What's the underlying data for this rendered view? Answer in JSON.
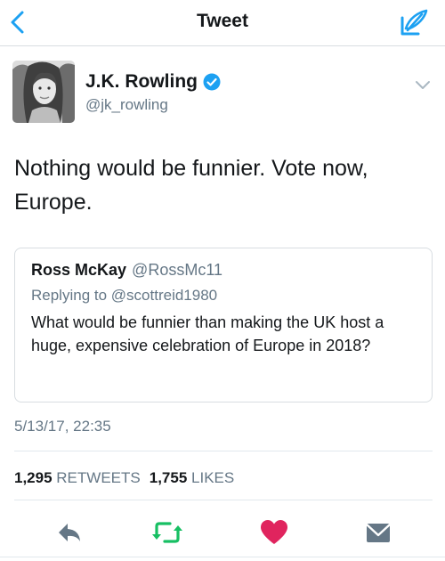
{
  "nav": {
    "title": "Tweet",
    "back_icon": "chevron-left-icon",
    "compose_icon": "compose-tweet-icon",
    "accent": "#1da1f2"
  },
  "tweet": {
    "author_name": "J.K. Rowling",
    "author_handle": "@jk_rowling",
    "verified": true,
    "text": "Nothing would be funnier. Vote now, Europe.",
    "timestamp": "5/13/17, 22:35"
  },
  "quoted": {
    "name": "Ross McKay",
    "handle": "@RossMc11",
    "reply_prefix": "Replying to",
    "reply_to": "@scottreid1980",
    "text": "What would be funnier than making the UK host a huge, expensive celebration of Europe in 2018?"
  },
  "stats": {
    "retweets_count": "1,295",
    "retweets_label": "RETWEETS",
    "likes_count": "1,755",
    "likes_label": "LIKES"
  },
  "actions": {
    "reply_icon": "reply-icon",
    "retweet_icon": "retweet-icon",
    "like_icon": "heart-icon",
    "dm_icon": "envelope-icon",
    "retweet_color": "#17bf63",
    "like_color": "#e0245e",
    "icon_color": "#657786"
  }
}
